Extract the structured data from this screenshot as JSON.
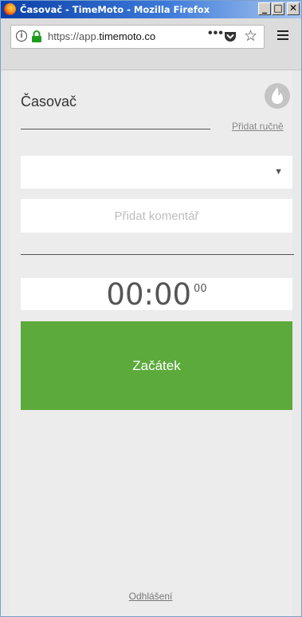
{
  "window": {
    "title": "Časovač - TimeMoto - Mozilla Firefox",
    "min_label": "_",
    "max_label": "□",
    "close_label": "✕"
  },
  "browser": {
    "url_prefix": "https://app.",
    "url_domain": "timemoto.co",
    "more_label": "•••",
    "star_label": "☆",
    "info_label": "i"
  },
  "page": {
    "title": "Časovač",
    "manual_link": "Přidat ručně",
    "select_value": "",
    "comment_placeholder": "Přidat komentář",
    "timer": {
      "main": "00:00",
      "seconds": "00"
    },
    "start_label": "Začátek",
    "logout_label": "Odhlášení"
  },
  "colors": {
    "accent": "#5caa3c",
    "titlebar": "#0a3fa8",
    "text": "#333333",
    "link": "#888888"
  }
}
